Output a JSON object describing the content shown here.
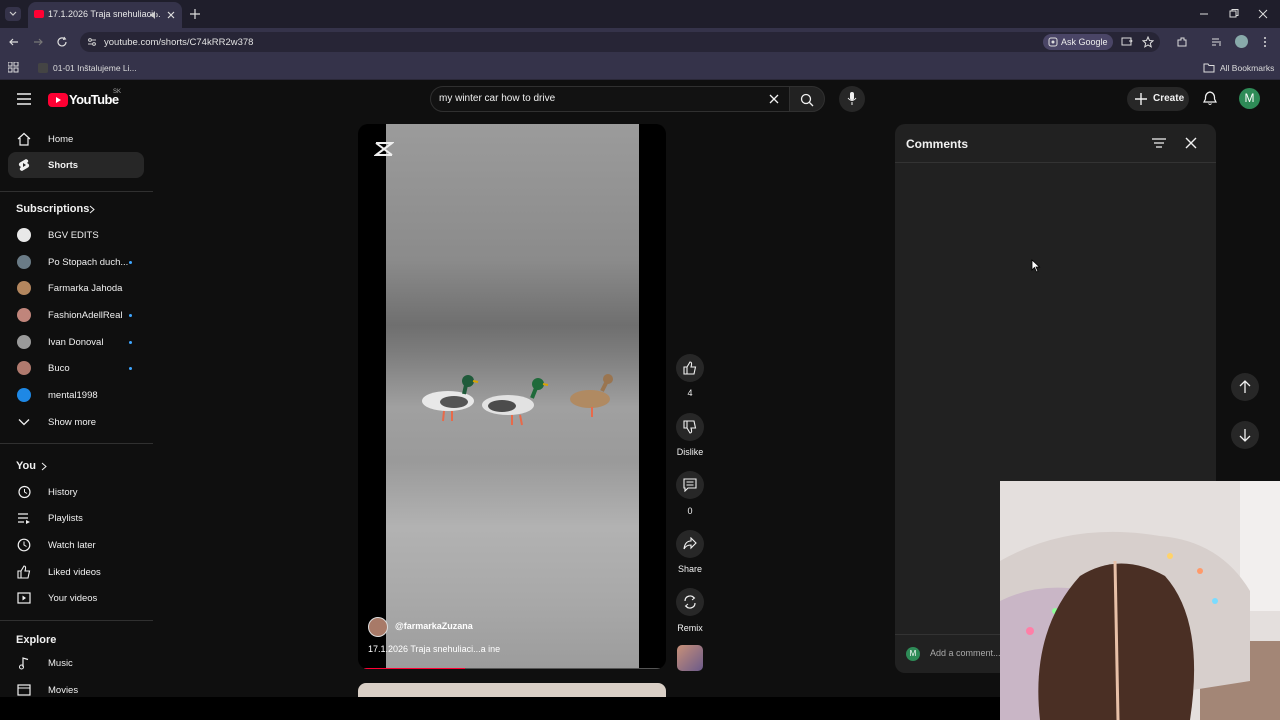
{
  "browser": {
    "tab_title": "17.1.2026 Traja snehuliaci...",
    "url": "youtube.com/shorts/C74kRR2w378",
    "ask_google": "Ask Google",
    "bookmark_item": "01-01 Inštalujeme Li...",
    "all_bookmarks": "All Bookmarks"
  },
  "header": {
    "logo_text": "YouTube",
    "region": "SK",
    "search_value": "my winter car how to drive",
    "create_label": "Create",
    "avatar_letter": "M"
  },
  "sidebar": {
    "main": [
      {
        "label": "Home",
        "icon": "home-icon"
      },
      {
        "label": "Shorts",
        "icon": "shorts-icon"
      }
    ],
    "subscriptions_title": "Subscriptions",
    "subscriptions": [
      {
        "label": "BGV EDITS",
        "new": false,
        "color": "#e8e8e8"
      },
      {
        "label": "Po Stopach duch...",
        "new": true,
        "color": "#6a7b86"
      },
      {
        "label": "Farmarka Jahoda",
        "new": false,
        "color": "#b3865e"
      },
      {
        "label": "FashionAdellReal",
        "new": true,
        "color": "#c0857b"
      },
      {
        "label": "Ivan Donoval",
        "new": true,
        "color": "#9a9a9a"
      },
      {
        "label": "Buco",
        "new": true,
        "color": "#b07a6e"
      },
      {
        "label": "mental1998",
        "new": false,
        "color": "#1e88e5"
      }
    ],
    "show_more": "Show more",
    "you_title": "You",
    "you_items": [
      {
        "label": "History",
        "icon": "history-icon"
      },
      {
        "label": "Playlists",
        "icon": "playlists-icon"
      },
      {
        "label": "Watch later",
        "icon": "watch-later-icon"
      },
      {
        "label": "Liked videos",
        "icon": "liked-videos-icon"
      },
      {
        "label": "Your videos",
        "icon": "your-videos-icon"
      }
    ],
    "explore_title": "Explore",
    "explore_items": [
      {
        "label": "Music",
        "icon": "music-icon"
      },
      {
        "label": "Movies",
        "icon": "movies-icon"
      }
    ]
  },
  "video": {
    "channel": "@farmarkaZuzana",
    "title": "17.1.2026 Traja snehuliaci...a ine",
    "progress": 0.34
  },
  "actions": {
    "like_count": "4",
    "dislike_label": "Dislike",
    "comment_count": "0",
    "share_label": "Share",
    "remix_label": "Remix"
  },
  "comments": {
    "title": "Comments",
    "add_placeholder": "Add a comment...",
    "user_letter": "M"
  },
  "colors": {
    "accent_red": "#ff0033",
    "background": "#0f0f0f",
    "panel": "#212121"
  }
}
